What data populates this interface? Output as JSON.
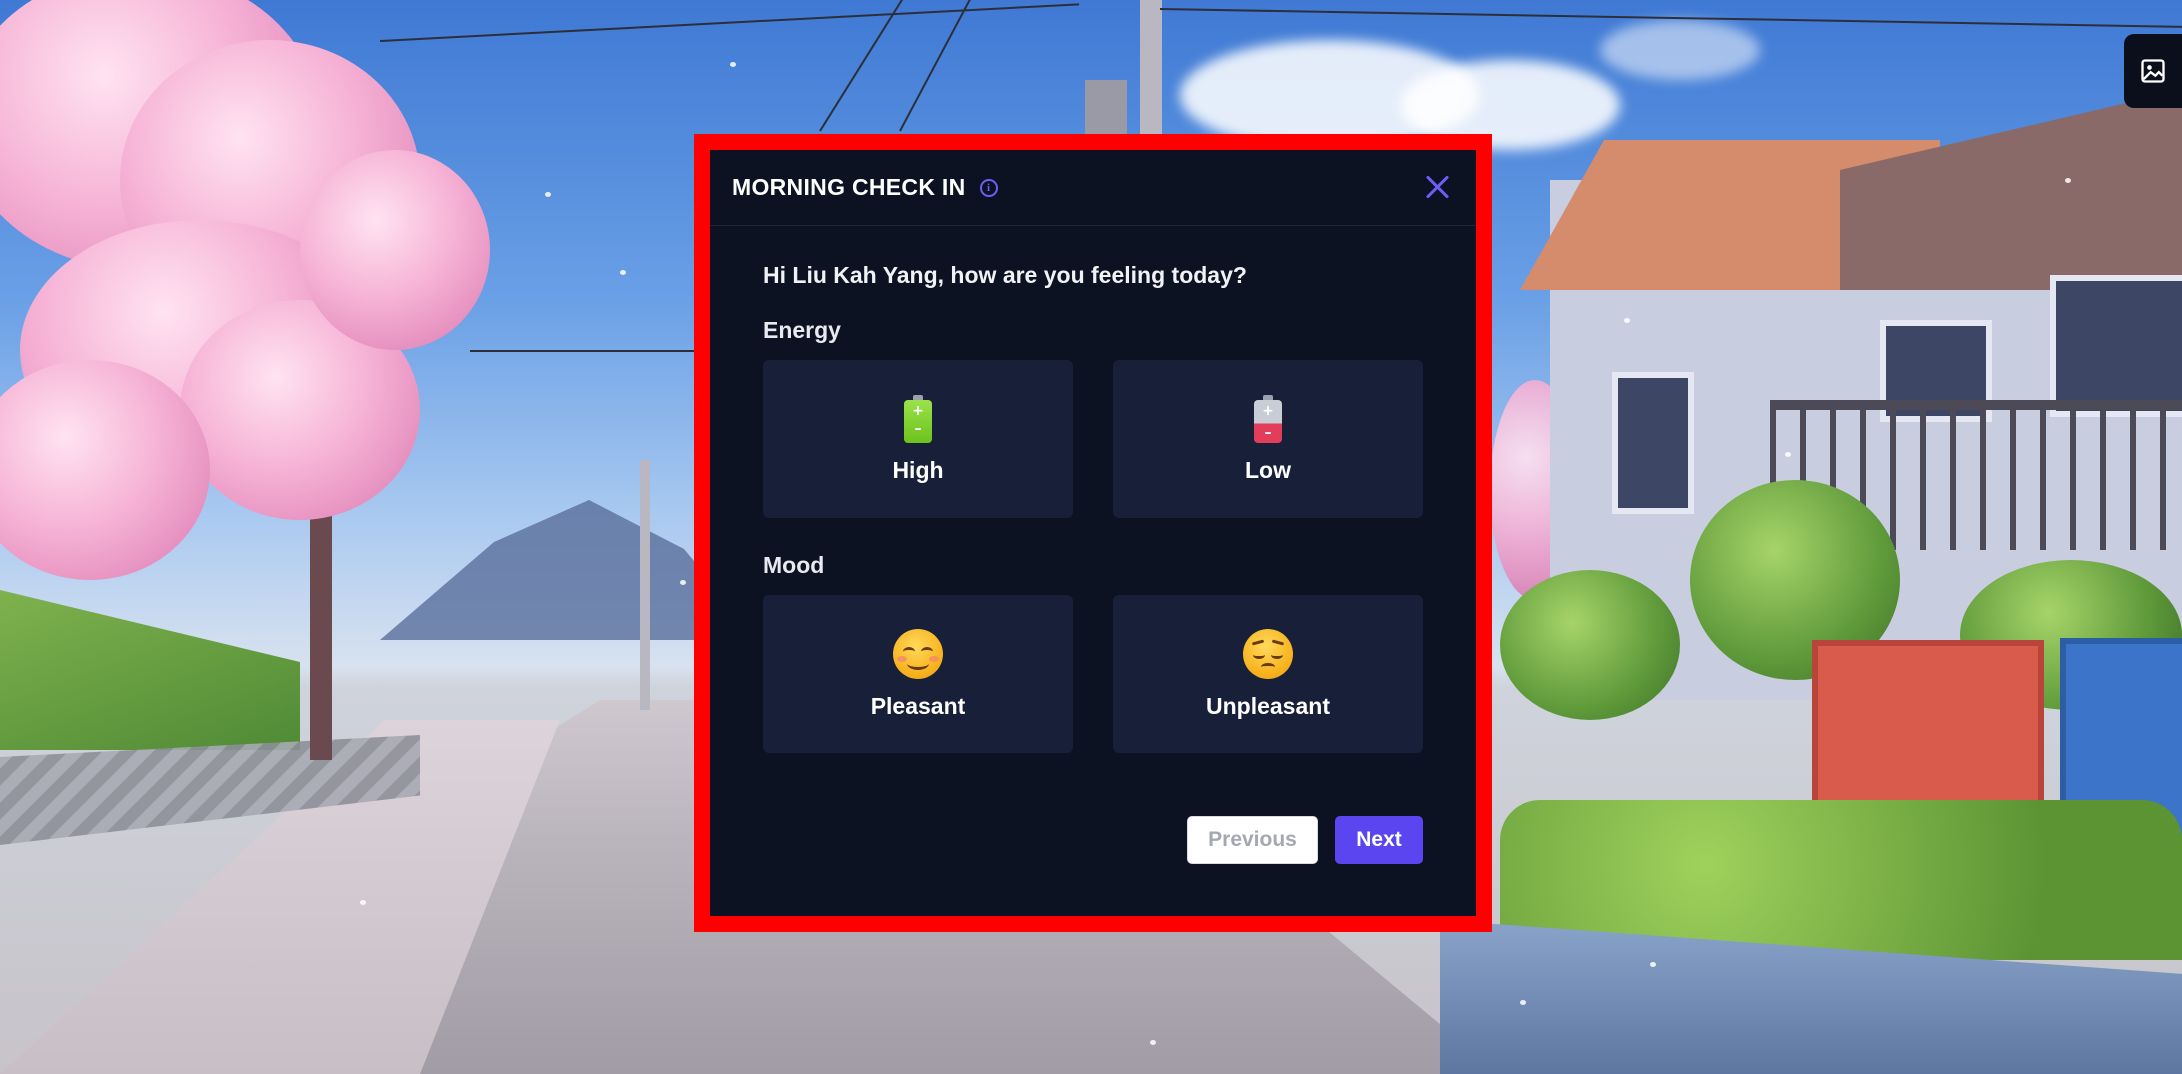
{
  "modal": {
    "title": "MORNING CHECK IN",
    "greeting": "Hi Liu Kah Yang, how are you feeling today?",
    "energy": {
      "label": "Energy",
      "options": [
        {
          "label": "High",
          "icon": "battery-full-icon",
          "color": "#7ed321"
        },
        {
          "label": "Low",
          "icon": "battery-low-icon",
          "color": "#e23d5a"
        }
      ]
    },
    "mood": {
      "label": "Mood",
      "options": [
        {
          "label": "Pleasant",
          "icon": "smiling-face-icon"
        },
        {
          "label": "Unpleasant",
          "icon": "pensive-face-icon"
        }
      ]
    },
    "buttons": {
      "previous": "Previous",
      "next": "Next"
    }
  },
  "colors": {
    "modal_bg": "#0c1222",
    "option_bg": "#172038",
    "accent": "#5b45f0",
    "highlight_border": "#ff0000"
  },
  "corner_button_icon": "image-icon"
}
